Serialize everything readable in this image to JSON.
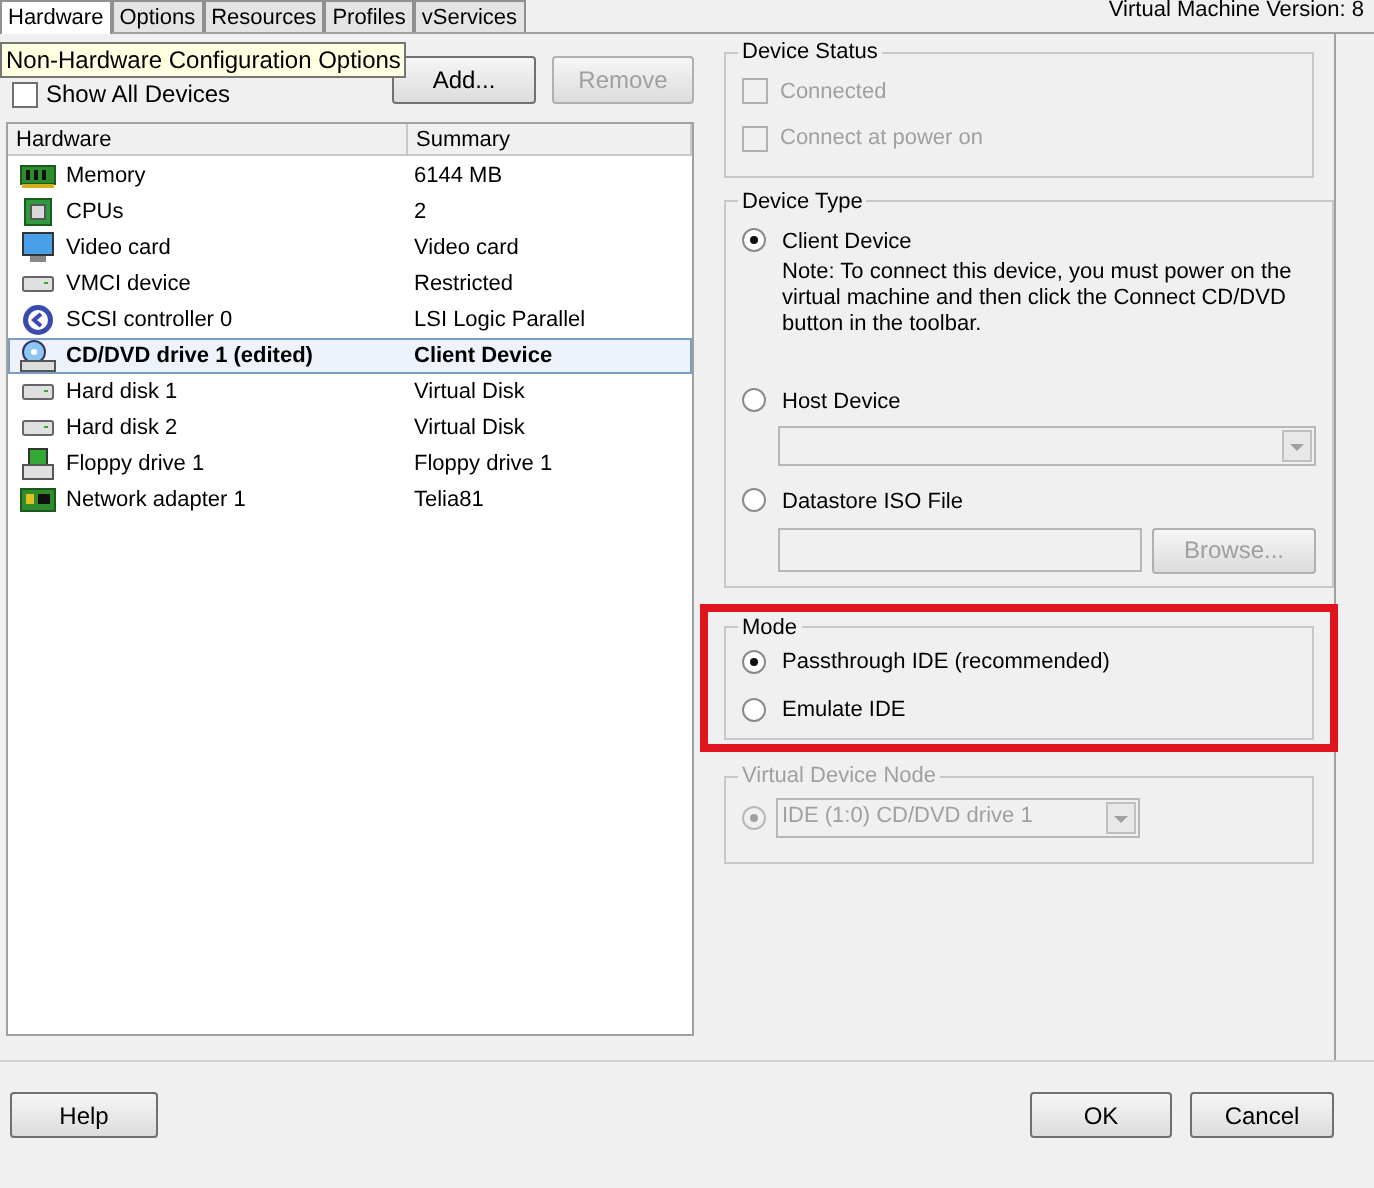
{
  "tabs": [
    {
      "label": "Hardware",
      "selected": true
    },
    {
      "label": "Options",
      "selected": false
    },
    {
      "label": "Resources",
      "selected": false
    },
    {
      "label": "Profiles",
      "selected": false
    },
    {
      "label": "vServices",
      "selected": false
    }
  ],
  "version": "Virtual Machine Version: 8",
  "tooltip": "Non-Hardware Configuration Options",
  "show_all_devices": {
    "label": "Show All Devices",
    "checked": false
  },
  "add_button": "Add...",
  "remove_button": {
    "label": "Remove",
    "disabled": true
  },
  "table": {
    "columns": [
      "Hardware",
      "Summary"
    ],
    "rows": [
      {
        "kind": "memory",
        "name": "Memory",
        "summary": "6144 MB",
        "selected": false
      },
      {
        "kind": "cpu",
        "name": "CPUs",
        "summary": "2",
        "selected": false
      },
      {
        "kind": "monitor",
        "name": "Video card",
        "summary": "Video card",
        "selected": false
      },
      {
        "kind": "drive",
        "name": "VMCI device",
        "summary": "Restricted",
        "selected": false
      },
      {
        "kind": "controller",
        "name": "SCSI controller 0",
        "summary": "LSI Logic Parallel",
        "selected": false
      },
      {
        "kind": "cdrom",
        "name": "CD/DVD drive 1 (edited)",
        "summary": "Client Device",
        "selected": true
      },
      {
        "kind": "drive",
        "name": "Hard disk 1",
        "summary": "Virtual Disk",
        "selected": false
      },
      {
        "kind": "drive",
        "name": "Hard disk 2",
        "summary": "Virtual Disk",
        "selected": false
      },
      {
        "kind": "floppy",
        "name": "Floppy drive 1",
        "summary": "Floppy drive 1",
        "selected": false
      },
      {
        "kind": "network",
        "name": "Network adapter 1",
        "summary": "Telia81",
        "selected": false
      }
    ]
  },
  "device_status": {
    "title": "Device Status",
    "options": [
      {
        "label": "Connected",
        "checked": false,
        "disabled": true
      },
      {
        "label": "Connect at power on",
        "checked": false,
        "disabled": true
      }
    ]
  },
  "device_type": {
    "title": "Device Type",
    "options": [
      {
        "kind": "note",
        "label": "Client Device",
        "selected": true,
        "note": "Note: To connect this device, you must power on the virtual machine and then click the Connect CD/DVD button in the toolbar."
      },
      {
        "kind": "dropdown",
        "label": "Host Device",
        "selected": false
      },
      {
        "kind": "file",
        "label": "Datastore ISO File",
        "selected": false,
        "button": "Browse..."
      }
    ]
  },
  "mode": {
    "title": "Mode",
    "highlighted": true,
    "options": [
      {
        "label": "Passthrough IDE (recommended)",
        "selected": true
      },
      {
        "label": "Emulate IDE",
        "selected": false
      }
    ]
  },
  "virtual_device_node": {
    "title": "Virtual Device Node",
    "disabled": true,
    "selected": true,
    "value": "IDE (1:0) CD/DVD drive 1"
  },
  "footer": {
    "help": "Help",
    "ok": "OK",
    "cancel": "Cancel"
  }
}
